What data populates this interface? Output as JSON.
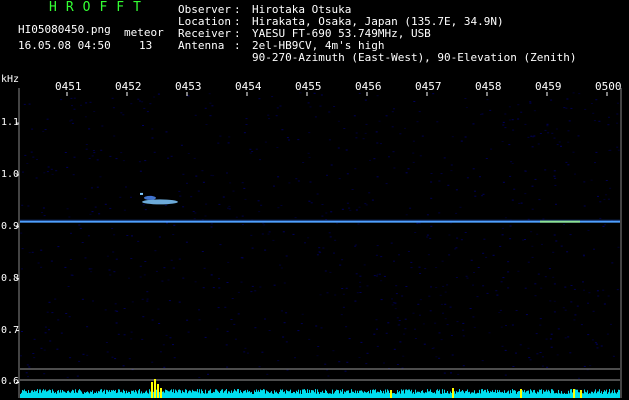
{
  "header": {
    "brand": "HROFFT",
    "filename": "HI05080450.png",
    "datetime": "16.05.08 04:50",
    "meteor_label": "meteor",
    "meteor_count": "13"
  },
  "info": [
    {
      "key": "Observer",
      "value": "Hirotaka Otsuka"
    },
    {
      "key": "Location",
      "value": "Hirakata, Osaka, Japan (135.7E, 34.9N)"
    },
    {
      "key": "Receiver",
      "value": "YAESU FT-690 53.749MHz, USB"
    },
    {
      "key": "Antenna",
      "value": "2el-HB9CV, 4m's high"
    },
    {
      "key": "",
      "value": "90-270-Azimuth (East-West), 90-Elevation (Zenith)"
    }
  ],
  "axis": {
    "unit": "kHz",
    "y_ticks": [
      "1.1",
      "1.0",
      "0.9",
      "0.8",
      "0.7",
      "0.6"
    ],
    "y_range": [
      0.57,
      1.16
    ],
    "time_ticks": [
      "0451",
      "0452",
      "0453",
      "0454",
      "0455",
      "0456",
      "0457",
      "0458",
      "0459",
      "0500"
    ]
  },
  "colors": {
    "background": "#000000",
    "carrier": "#4fa0ff",
    "meteor_echo": "#7fc8ff",
    "signal_bar": "#00ddee",
    "peak": "#ffff00",
    "brand": "#33ff33"
  },
  "signal": {
    "carrier_khz": 0.91,
    "meteor_echo_khz": 0.95
  }
}
